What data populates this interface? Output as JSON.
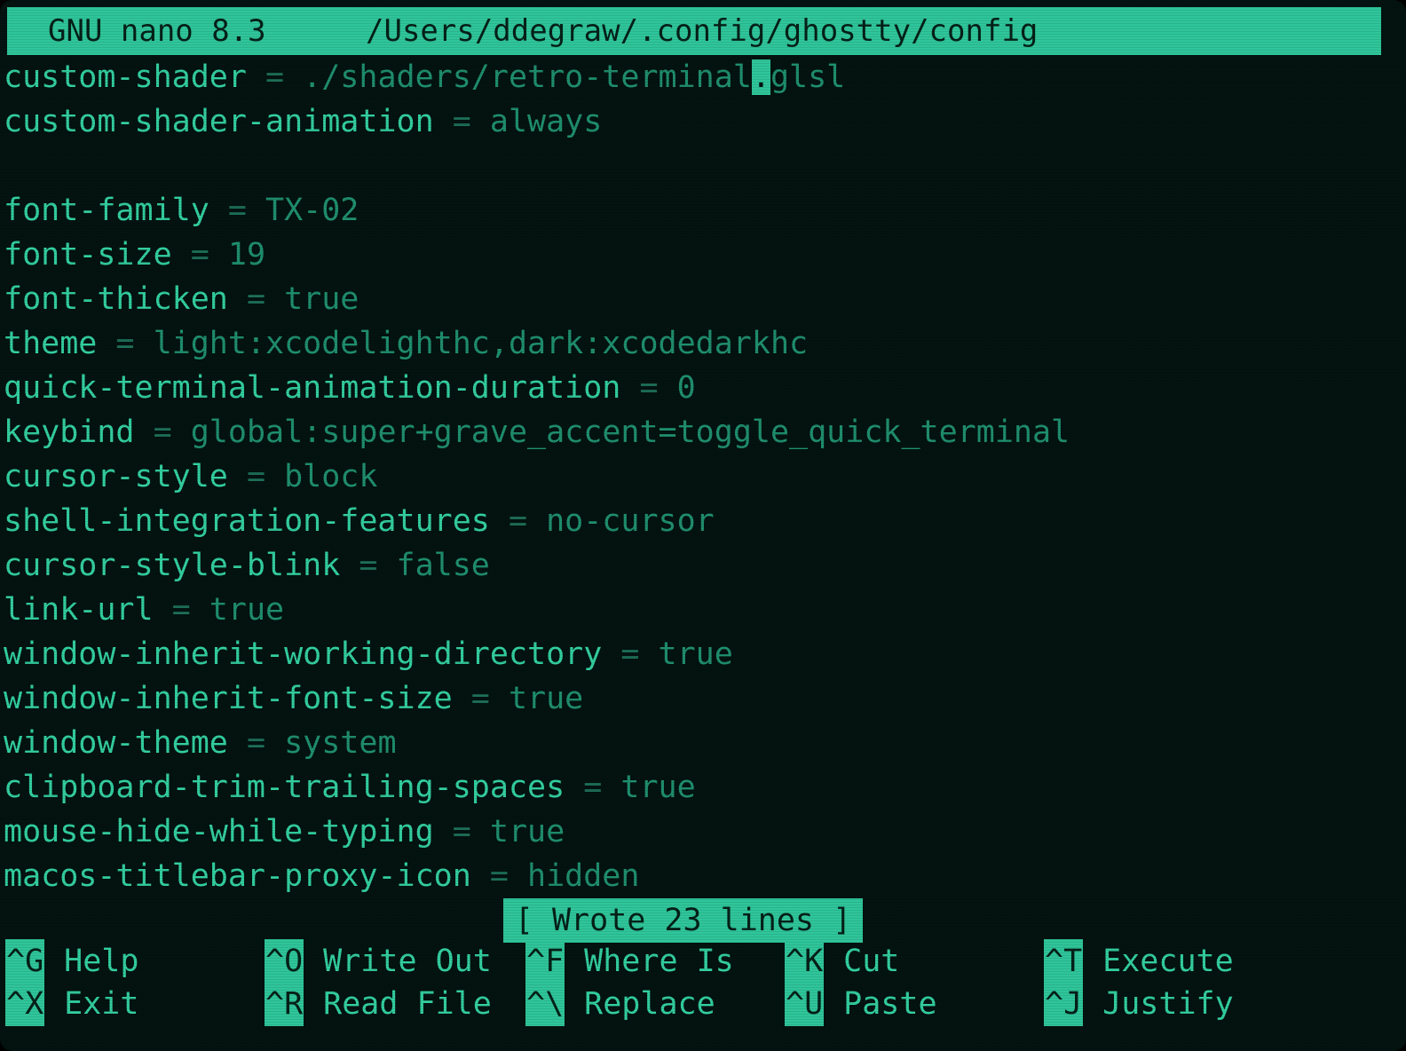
{
  "header": {
    "app": "GNU nano 8.3",
    "path": "/Users/ddegraw/.config/ghostty/config"
  },
  "colors": {
    "background": "#03130f",
    "accent": "#2fc59a",
    "key_text": "#33cf9f",
    "value_text": "#1f8f6d"
  },
  "lines": [
    {
      "key": "custom-shader",
      "value": "./shaders/retro-terminal",
      "cursor": ".",
      "rest": "glsl"
    },
    {
      "key": "custom-shader-animation",
      "value": "always"
    },
    {
      "key": "",
      "value": ""
    },
    {
      "key": "font-family",
      "value": "TX-02"
    },
    {
      "key": "font-size",
      "value": "19"
    },
    {
      "key": "font-thicken",
      "value": "true"
    },
    {
      "key": "theme",
      "value": "light:xcodelighthc,dark:xcodedarkhc"
    },
    {
      "key": "quick-terminal-animation-duration",
      "value": "0"
    },
    {
      "key": "keybind",
      "value": "global:super+grave_accent=toggle_quick_terminal"
    },
    {
      "key": "cursor-style",
      "value": "block"
    },
    {
      "key": "shell-integration-features",
      "value": "no-cursor"
    },
    {
      "key": "cursor-style-blink",
      "value": "false"
    },
    {
      "key": "link-url",
      "value": "true"
    },
    {
      "key": "window-inherit-working-directory",
      "value": "true"
    },
    {
      "key": "window-inherit-font-size",
      "value": "true"
    },
    {
      "key": "window-theme",
      "value": "system"
    },
    {
      "key": "clipboard-trim-trailing-spaces",
      "value": "true"
    },
    {
      "key": "mouse-hide-while-typing",
      "value": "true"
    },
    {
      "key": "macos-titlebar-proxy-icon",
      "value": "hidden"
    }
  ],
  "status": "[ Wrote 23 lines ]",
  "shortcuts": [
    {
      "key": "^G",
      "label": "Help"
    },
    {
      "key": "^X",
      "label": "Exit"
    },
    {
      "key": "^O",
      "label": "Write Out"
    },
    {
      "key": "^R",
      "label": "Read File"
    },
    {
      "key": "^F",
      "label": "Where Is"
    },
    {
      "key": "^\\",
      "label": "Replace"
    },
    {
      "key": "^K",
      "label": "Cut"
    },
    {
      "key": "^U",
      "label": "Paste"
    },
    {
      "key": "^T",
      "label": "Execute"
    },
    {
      "key": "^J",
      "label": "Justify"
    }
  ]
}
